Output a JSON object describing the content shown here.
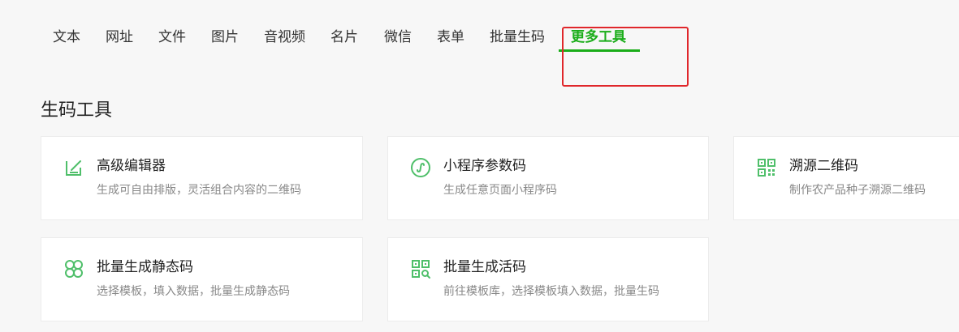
{
  "tabs": [
    {
      "label": "文本"
    },
    {
      "label": "网址"
    },
    {
      "label": "文件"
    },
    {
      "label": "图片"
    },
    {
      "label": "音视频"
    },
    {
      "label": "名片"
    },
    {
      "label": "微信"
    },
    {
      "label": "表单"
    },
    {
      "label": "批量生码"
    },
    {
      "label": "更多工具",
      "active": true
    }
  ],
  "section": {
    "title": "生码工具"
  },
  "tools": [
    {
      "title": "高级编辑器",
      "desc": "生成可自由排版，灵活组合内容的二维码",
      "icon": "edit-icon"
    },
    {
      "title": "小程序参数码",
      "desc": "生成任意页面小程序码",
      "icon": "mini-program-icon"
    },
    {
      "title": "溯源二维码",
      "desc": "制作农产品种子溯源二维码",
      "icon": "trace-qr-icon"
    },
    {
      "title": "批量生成静态码",
      "desc": "选择模板，填入数据，批量生成静态码",
      "icon": "grid-circles-icon"
    },
    {
      "title": "批量生成活码",
      "desc": "前往模板库，选择模板填入数据，批量生码",
      "icon": "qr-search-icon"
    }
  ],
  "colors": {
    "accent": "#1aad19",
    "highlight": "#e0272b",
    "icon": "#4fbf6a"
  }
}
